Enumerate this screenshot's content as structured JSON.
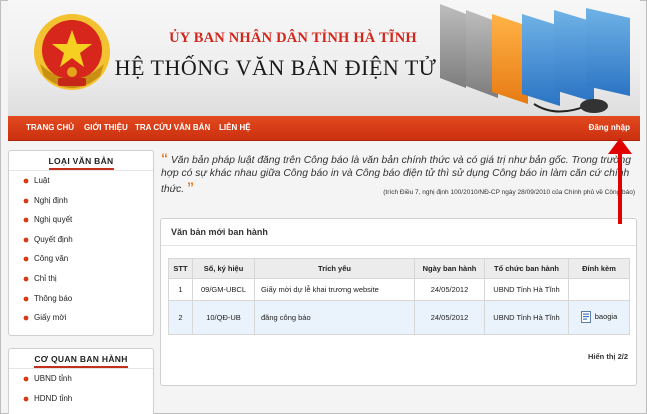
{
  "header": {
    "title_line1": "ỦY BAN NHÂN DÂN TỈNH HÀ TĨNH",
    "title_line2": "HỆ THỐNG VĂN BẢN ĐIỆN TỬ"
  },
  "nav": {
    "items": [
      "TRANG CHỦ",
      "GIỚI THIỆU",
      "TRA CỨU VĂN BẢN",
      "LIÊN HỆ"
    ],
    "login": "Đăng nhập"
  },
  "sidebar": {
    "doc_types": {
      "title": "LOẠI VĂN BẢN",
      "items": [
        "Luật",
        "Nghị định",
        "Nghị quyết",
        "Quyết định",
        "Công văn",
        "Chỉ thị",
        "Thông báo",
        "Giấy mời"
      ]
    },
    "agencies": {
      "title": "CƠ QUAN BAN HÀNH",
      "items": [
        "UBND tỉnh",
        "HDND tỉnh"
      ]
    }
  },
  "quote": {
    "text": "Văn bản pháp luật đăng trên Công báo là văn bản chính thức và có giá trị như bản gốc. Trong trường hợp có sự khác nhau giữa Công báo in và Công báo điện tử thì sử dụng Công báo in làm căn cứ chính thức.",
    "citation": "(trích Điều 7, nghị định 100/2010/NĐ-CP ngày 28/09/2010 của Chính phủ về Công báo)"
  },
  "main": {
    "title": "Văn bản mới ban hành",
    "columns": [
      "STT",
      "Số, ký hiệu",
      "Trích yếu",
      "Ngày ban hành",
      "Tổ chức ban hành",
      "Đính kèm"
    ],
    "rows": [
      {
        "stt": "1",
        "so": "09/GM-UBCL",
        "trich_yeu": "Giấy mời dự lễ khai trương website",
        "ngay": "24/05/2012",
        "to_chuc": "UBND Tỉnh Hà Tĩnh",
        "dinh_kem": ""
      },
      {
        "stt": "2",
        "so": "10/QĐ-UB",
        "trich_yeu": "đăng công báo",
        "ngay": "24/05/2012",
        "to_chuc": "UBND Tỉnh Hà Tĩnh",
        "dinh_kem": "baogia"
      }
    ],
    "paging": "Hiển thị 2/2"
  },
  "colors": {
    "nav_red": "#d63a15",
    "title_red": "#d2261b",
    "arrow_red": "#e00000"
  }
}
